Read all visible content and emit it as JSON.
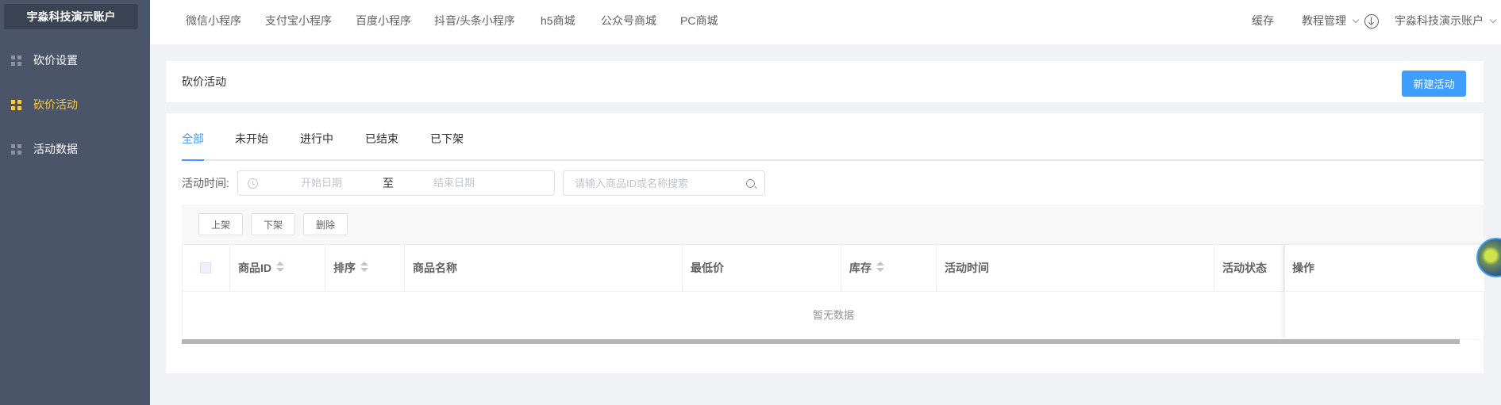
{
  "sidebar": {
    "brand": "宇淼科技演示账户",
    "items": [
      {
        "label": "砍价设置",
        "active": false
      },
      {
        "label": "砍价活动",
        "active": true
      },
      {
        "label": "活动数据",
        "active": false
      }
    ]
  },
  "topnav": {
    "links": [
      "微信小程序",
      "支付宝小程序",
      "百度小程序",
      "抖音/头条小程序",
      "h5商城",
      "公众号商城",
      "PC商城"
    ],
    "cache": "缓存",
    "tutorial": "教程管理",
    "account": "宇淼科技演示账户"
  },
  "header": {
    "title": "砍价活动",
    "new_button": "新建活动"
  },
  "tabs": [
    "全部",
    "未开始",
    "进行中",
    "已结束",
    "已下架"
  ],
  "filter": {
    "label": "活动时间:",
    "start_placeholder": "开始日期",
    "separator": "至",
    "end_placeholder": "结束日期",
    "search_placeholder": "请输入商品ID或名称搜索"
  },
  "batch": {
    "on_shelf": "上架",
    "off_shelf": "下架",
    "delete": "删除"
  },
  "table": {
    "columns": [
      "商品ID",
      "排序",
      "商品名称",
      "最低价",
      "库存",
      "活动时间",
      "活动状态",
      "操作"
    ],
    "empty": "暂无数据"
  },
  "colors": {
    "sidebar_bg": "#4b5569",
    "active_accent": "#f7c948",
    "primary": "#409eff"
  }
}
